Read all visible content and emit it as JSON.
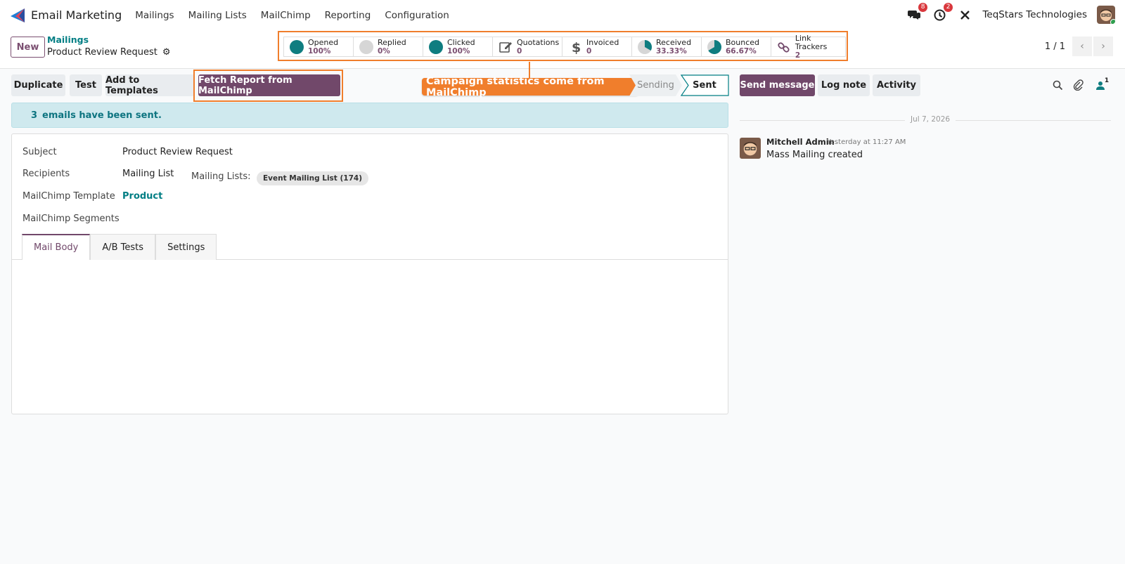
{
  "navbar": {
    "app_name": "Email Marketing",
    "menu": [
      "Mailings",
      "Mailing Lists",
      "MailChimp",
      "Reporting",
      "Configuration"
    ],
    "messages_count": "8",
    "activities_count": "2",
    "company": "TeqStars Technologies"
  },
  "control": {
    "new_label": "New",
    "breadcrumb": "Mailings",
    "record_title": "Product Review Request",
    "pager": "1 / 1"
  },
  "stats": [
    {
      "label": "Opened",
      "value": "100%",
      "icon": "full-circle"
    },
    {
      "label": "Replied",
      "value": "0%",
      "icon": "empty-circle"
    },
    {
      "label": "Clicked",
      "value": "100%",
      "icon": "full-circle"
    },
    {
      "label": "Quotations",
      "value": "0",
      "icon": "pencil-square-icon"
    },
    {
      "label": "Invoiced",
      "value": "0",
      "icon": "dollar-icon"
    },
    {
      "label": "Received",
      "value": "33.33%",
      "icon": "pie-third"
    },
    {
      "label": "Bounced",
      "value": "66.67%",
      "icon": "pie-two-thirds"
    },
    {
      "label": "Link Trackers",
      "value": "2",
      "icon": "link-icon"
    }
  ],
  "actions": {
    "duplicate": "Duplicate",
    "test": "Test",
    "add_templates": "Add to Templates",
    "fetch_report": "Fetch Report from MailChimp",
    "callout": "Campaign statistics come from MailChimp",
    "status_sending": "Sending",
    "status_sent": "Sent"
  },
  "alert": {
    "count": "3",
    "text": "emails have been sent."
  },
  "form": {
    "subject_label": "Subject",
    "subject_value": "Product Review Request",
    "recipients_label": "Recipients",
    "recipients_value": "Mailing List",
    "mailing_lists_label": "Mailing Lists:",
    "mailing_list_tag": "Event Mailing List (174)",
    "template_label": "MailChimp Template",
    "template_value": "Product",
    "segments_label": "MailChimp Segments",
    "tabs": [
      "Mail Body",
      "A/B Tests",
      "Settings"
    ]
  },
  "chatter": {
    "send_message": "Send message",
    "log_note": "Log note",
    "activity": "Activity",
    "followers": "1",
    "date": "Jul 7, 2026",
    "author": "Mitchell Admin",
    "time": "Yesterday at 11:27 AM",
    "body": "Mass Mailing created"
  },
  "colors": {
    "primary": "#71486a",
    "teal": "#017e84",
    "highlight": "#f07e2c"
  }
}
